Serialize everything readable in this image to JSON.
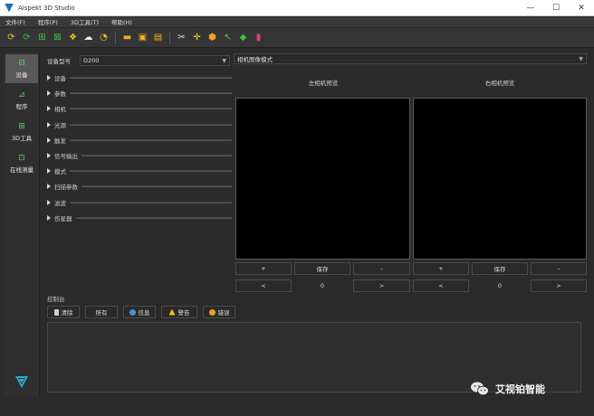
{
  "window": {
    "title": "Aispekt 3D Studio",
    "controls": [
      "—",
      "☐",
      "✕"
    ]
  },
  "menu": [
    "文件(F)",
    "程序(P)",
    "3D工具(T)",
    "帮助(H)"
  ],
  "toolbar_icons": [
    {
      "name": "refresh-yellow-icon",
      "glyph": "⟳",
      "color": "#f0c020"
    },
    {
      "name": "refresh-green-icon",
      "glyph": "⟳",
      "color": "#30c030"
    },
    {
      "name": "grid-select-icon",
      "glyph": "⊞",
      "color": "#40c040"
    },
    {
      "name": "grid-scan-icon",
      "glyph": "⊠",
      "color": "#40c040"
    },
    {
      "name": "cluster-icon",
      "glyph": "❖",
      "color": "#f0c020"
    },
    {
      "name": "cloud-icon",
      "glyph": "☁",
      "color": "#f0f0f0"
    },
    {
      "name": "cycle-icon",
      "glyph": "◔",
      "color": "#f0c020"
    },
    {
      "name": "folder-icon",
      "glyph": "▬",
      "color": "#f0b020"
    },
    {
      "name": "camera-save-icon",
      "glyph": "▣",
      "color": "#f0b020"
    },
    {
      "name": "save-icon",
      "glyph": "▤",
      "color": "#f0b020"
    },
    {
      "name": "scissors-icon",
      "glyph": "✂",
      "color": "#e0e0e0"
    },
    {
      "name": "crosshair-icon",
      "glyph": "✛",
      "color": "#f0d020"
    },
    {
      "name": "cube-icon",
      "glyph": "⬢",
      "color": "#f0a020"
    },
    {
      "name": "point-pick-icon",
      "glyph": "↖",
      "color": "#40d040"
    },
    {
      "name": "green-cube-icon",
      "glyph": "◆",
      "color": "#40c040"
    },
    {
      "name": "color-map-icon",
      "glyph": "▮",
      "color": "#e04080"
    }
  ],
  "sidebar": [
    {
      "label": "设备",
      "icon": "camera-icon",
      "glyph": "⊟",
      "active": true
    },
    {
      "label": "程序",
      "icon": "program-icon",
      "glyph": "⊿",
      "active": false
    },
    {
      "label": "3D工具",
      "icon": "3d-tool-icon",
      "glyph": "⊞",
      "active": false
    },
    {
      "label": "在线测量",
      "icon": "measure-icon",
      "glyph": "⊡",
      "active": false
    }
  ],
  "device": {
    "label": "设备型号",
    "value": "D200"
  },
  "sections": [
    "设备",
    "参数",
    "相机",
    "光源",
    "触发",
    "信号输出",
    "模式",
    "扫描参数",
    "滤波",
    "伤星器"
  ],
  "view_mode": "相机图像模式",
  "cameras": {
    "left": {
      "title": "左相机预览",
      "plus": "+",
      "save": "保存",
      "minus": "-",
      "prev": "<",
      "value": "0",
      "next": ">"
    },
    "right": {
      "title": "右相机预览",
      "plus": "+",
      "save": "保存",
      "minus": "-",
      "prev": "<",
      "value": "0",
      "next": ">"
    }
  },
  "console": {
    "label": "控制台",
    "buttons": [
      {
        "label": "清除",
        "icon": "clear-icon",
        "color": "#cfcfcf"
      },
      {
        "label": "所有",
        "icon": "",
        "color": ""
      },
      {
        "label": "信息",
        "icon": "info-icon",
        "color": "#4a8fd8"
      },
      {
        "label": "警告",
        "icon": "warning-icon",
        "color": "#f0c020"
      },
      {
        "label": "错误",
        "icon": "error-icon",
        "color": "#f0a020"
      }
    ]
  },
  "watermark": "艾视铂智能"
}
